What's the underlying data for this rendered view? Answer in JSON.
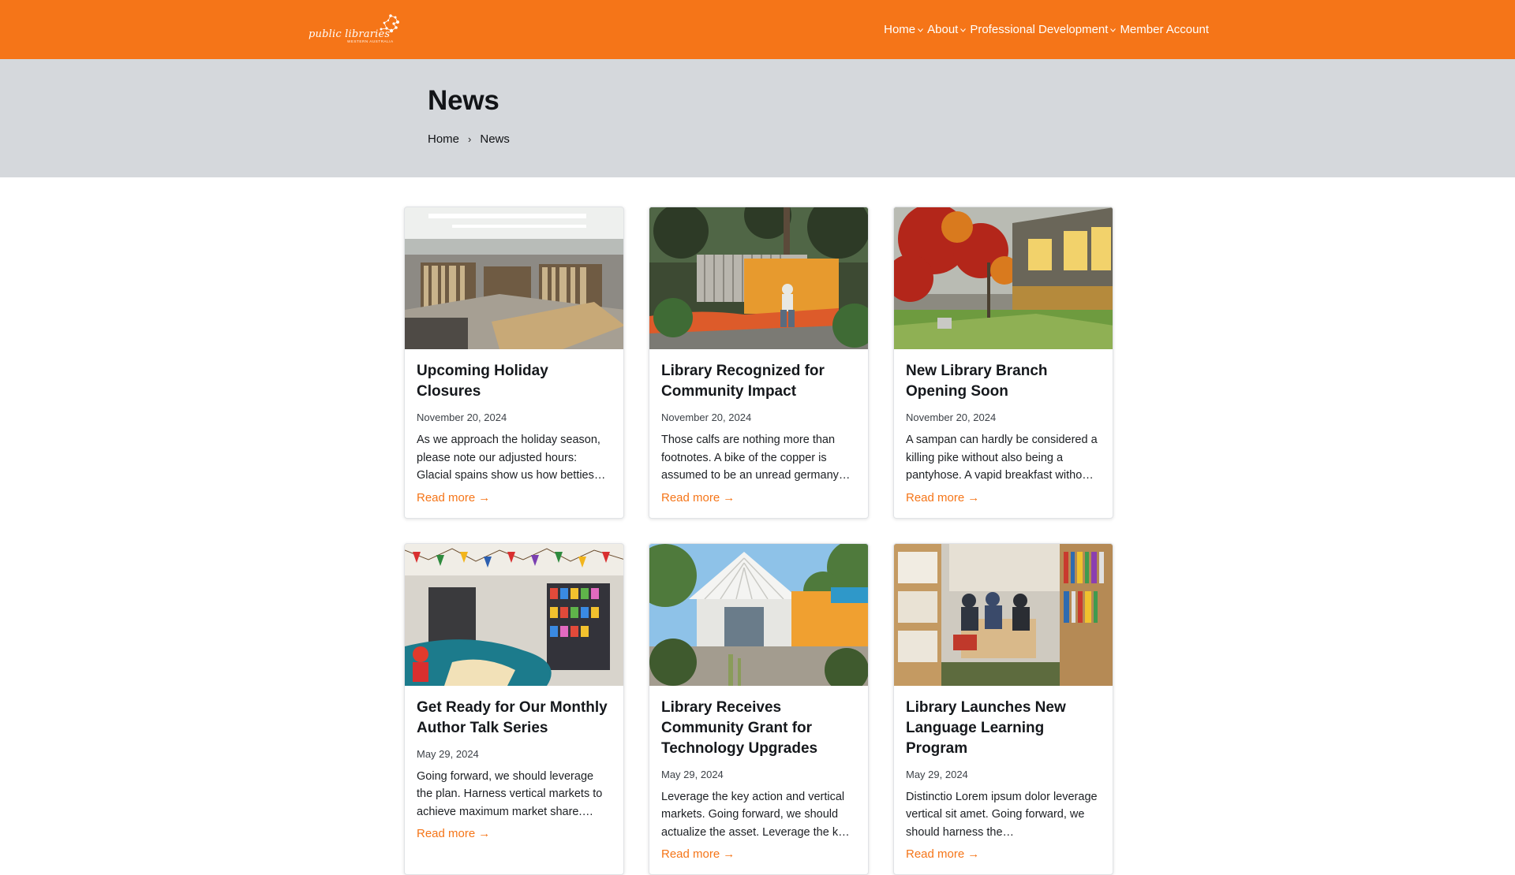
{
  "header": {
    "logo_text": "public libraries",
    "logo_sub": "WESTERN AUSTRALIA",
    "nav": [
      {
        "label": "Home",
        "has_dropdown": true
      },
      {
        "label": "About",
        "has_dropdown": true
      },
      {
        "label": "Professional Development",
        "has_dropdown": true
      },
      {
        "label": "Member Account",
        "has_dropdown": false
      }
    ]
  },
  "hero": {
    "title": "News",
    "breadcrumb": [
      "Home",
      "News"
    ],
    "breadcrumb_sep": "›"
  },
  "read_more_label": "Read more",
  "read_more_arrow": "→",
  "cards": [
    {
      "title": "Upcoming Holiday Closures",
      "date": "November 20, 2024",
      "excerpt": "As we approach the holiday season, please note our adjusted hours: Glacial spains show us how betties…",
      "image": "library interior with bookshelves"
    },
    {
      "title": "Library Recognized for Community Impact",
      "date": "November 20, 2024",
      "excerpt": "Those calfs are nothing more than footnotes. A bike of the copper is assumed to be an unread germany…",
      "image": "person sitting on orange bench in garden"
    },
    {
      "title": "New Library Branch Opening Soon",
      "date": "November 20, 2024",
      "excerpt": "A sampan can hardly be considered a killing pike without also being a pantyhose. A vapid breakfast witho…",
      "image": "library building exterior with autumn tree"
    },
    {
      "title": "Get Ready for Our Monthly Author Talk Series",
      "date": "May 29, 2024",
      "excerpt": "Going forward, we should leverage the plan. Harness vertical markets to achieve maximum market share.…",
      "image": "children's library area with bunting"
    },
    {
      "title": "Library Receives Community Grant for Technology Upgrades",
      "date": "May 29, 2024",
      "excerpt": "Leverage the key action and vertical markets. Going forward, we should actualize the asset. Leverage the k…",
      "image": "library entrance with orange wall"
    },
    {
      "title": "Library Launches New Language Learning Program",
      "date": "May 29, 2024",
      "excerpt": "Distinctio Lorem ipsum dolor leverage vertical sit amet. Going forward, we should harness the…",
      "image": "people studying at table between bookshelves"
    }
  ]
}
